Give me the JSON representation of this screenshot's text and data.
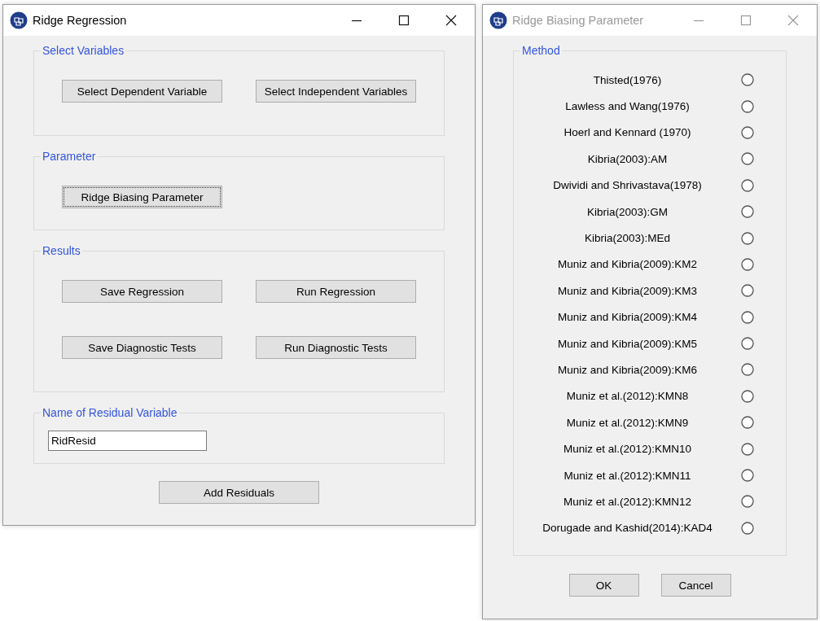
{
  "windows": [
    {
      "title": "Ridge Regression",
      "active": true,
      "groups": [
        {
          "label": "Select Variables",
          "kind": "buttons",
          "buttons": [
            {
              "label": "Select Dependent Variable",
              "focused": false
            },
            {
              "label": "Select Independent Variables",
              "focused": false
            }
          ]
        },
        {
          "label": "Parameter",
          "kind": "buttons",
          "buttons": [
            {
              "label": "Ridge Biasing Parameter",
              "focused": true
            }
          ]
        },
        {
          "label": "Results",
          "kind": "buttons",
          "buttons": [
            {
              "label": "Save Regression",
              "focused": false
            },
            {
              "label": "Run Regression",
              "focused": false
            },
            {
              "label": "Save Diagnostic Tests",
              "focused": false
            },
            {
              "label": "Run Diagnostic Tests",
              "focused": false
            }
          ]
        },
        {
          "label": "Name of Residual Variable",
          "kind": "input",
          "value": "RidResid"
        }
      ],
      "footer_buttons": [
        {
          "label": "Add Residuals",
          "focused": false
        }
      ]
    },
    {
      "title": "Ridge Biasing Parameter",
      "active": false,
      "groups": [
        {
          "label": "Method",
          "kind": "radios",
          "options": [
            {
              "label": "Thisted(1976)",
              "selected": false
            },
            {
              "label": "Lawless and Wang(1976)",
              "selected": false
            },
            {
              "label": "Hoerl and Kennard (1970)",
              "selected": false
            },
            {
              "label": "Kibria(2003):AM",
              "selected": false
            },
            {
              "label": "Dwividi and Shrivastava(1978)",
              "selected": false
            },
            {
              "label": "Kibria(2003):GM",
              "selected": false
            },
            {
              "label": "Kibria(2003):MEd",
              "selected": false
            },
            {
              "label": "Muniz and Kibria(2009):KM2",
              "selected": false
            },
            {
              "label": "Muniz and Kibria(2009):KM3",
              "selected": false
            },
            {
              "label": "Muniz and Kibria(2009):KM4",
              "selected": false
            },
            {
              "label": "Muniz and Kibria(2009):KM5",
              "selected": false
            },
            {
              "label": "Muniz and Kibria(2009):KM6",
              "selected": false
            },
            {
              "label": "Muniz et al.(2012):KMN8",
              "selected": false
            },
            {
              "label": "Muniz et al.(2012):KMN9",
              "selected": false
            },
            {
              "label": "Muniz et al.(2012):KMN10",
              "selected": false
            },
            {
              "label": "Muniz et al.(2012):KMN11",
              "selected": false
            },
            {
              "label": "Muniz et al.(2012):KMN12",
              "selected": false
            },
            {
              "label": "Dorugade and Kashid(2014):KAD4",
              "selected": false
            }
          ]
        }
      ],
      "footer_buttons": [
        {
          "label": "OK",
          "focused": false
        },
        {
          "label": "Cancel",
          "focused": false
        }
      ]
    }
  ]
}
